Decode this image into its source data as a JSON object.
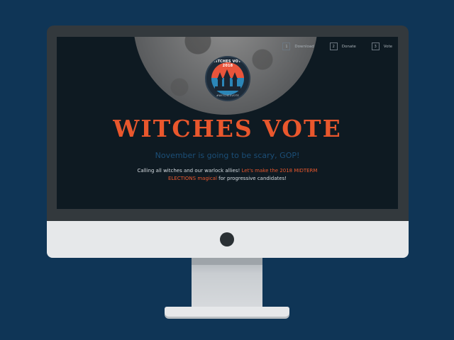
{
  "nav": {
    "items": [
      {
        "num": "1",
        "label": "Download"
      },
      {
        "num": "2",
        "label": "Donate"
      },
      {
        "num": "3",
        "label": "Vote"
      }
    ]
  },
  "badge": {
    "title": "WITCHES VOTE 2018",
    "subtitle": "#WITCHESVOTE"
  },
  "hero": {
    "title": "WITCHES VOTE",
    "tagline": "November is going to be scary, GOP!",
    "desc_part1": "Calling all witches and our warlock allies! ",
    "desc_highlight": "Let's make the 2018 MIDTERM ELECTIONS magical",
    "desc_part2": " for progressive candidates!"
  },
  "colors": {
    "background": "#0f3556",
    "screen": "#0e1a22",
    "accent": "#e9572d",
    "tagline": "#1c4f78"
  }
}
